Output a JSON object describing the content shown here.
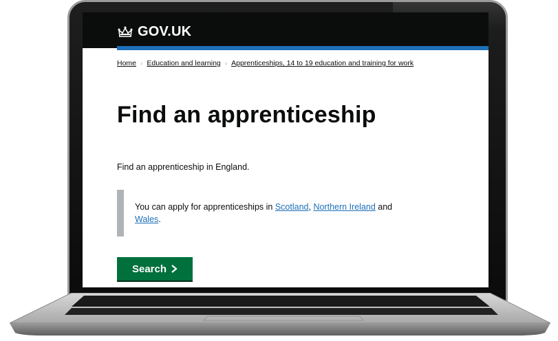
{
  "header": {
    "logo_text": "GOV.UK",
    "logo_icon": "crown-icon",
    "background": "#0b0c0c",
    "accent_bar": "#1d70b8"
  },
  "breadcrumbs": [
    {
      "label": "Home"
    },
    {
      "label": "Education and learning"
    },
    {
      "label": "Apprenticeships, 14 to 19 education and training for work"
    }
  ],
  "main": {
    "title": "Find an apprenticeship",
    "lead": "Find an apprenticeship in England.",
    "inset": {
      "prefix": "You can apply for apprenticeships in ",
      "link_scotland": "Scotland",
      "sep_comma": ", ",
      "link_ni": "Northern Ireland",
      "and_text": " and ",
      "link_wales": "Wales",
      "suffix": "."
    },
    "button": {
      "label": "Search",
      "icon": "chevron-right-icon",
      "color": "#00703c"
    }
  }
}
